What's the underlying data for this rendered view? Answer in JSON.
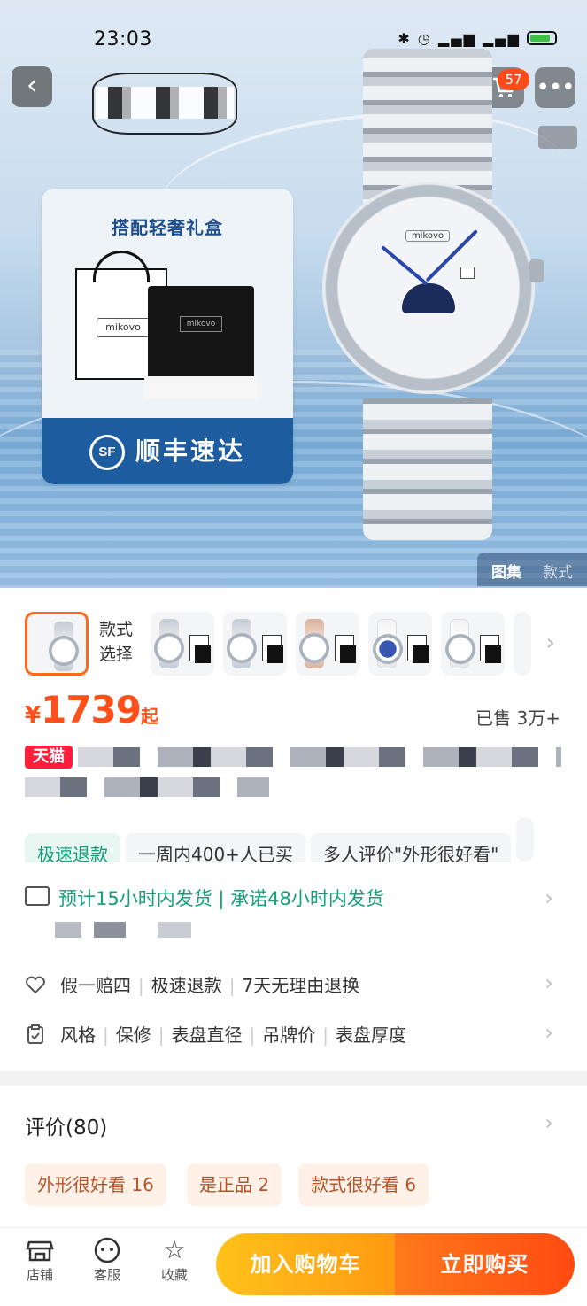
{
  "status_bar": {
    "time": "23:03",
    "battery": "91"
  },
  "nav": {
    "cart_count": "57"
  },
  "hero": {
    "gift_title": "搭配轻奢礼盒",
    "bag_label": "mikovo",
    "box_label": "mikovo",
    "shipping_banner": "顺丰速达",
    "sf_mark": "SF",
    "dial_brand": "mikovo",
    "gallery_tabs": [
      "图集",
      "款式"
    ]
  },
  "variants": {
    "label": "款式选择",
    "count": 6
  },
  "price": {
    "currency": "¥",
    "amount": "1739",
    "suffix": "起"
  },
  "sold": "已售 3万+",
  "title": {
    "platform": "天猫"
  },
  "tags": [
    "极速退款",
    "一周内400+人已买",
    "多人评价\"外形很好看\""
  ],
  "shipping": {
    "text": "预计15小时内发货 | 承诺48小时内发货"
  },
  "guarantees": [
    "假一赔四",
    "极速退款",
    "7天无理由退换"
  ],
  "params": [
    "风格",
    "保修",
    "表盘直径",
    "吊牌价",
    "表盘厚度"
  ],
  "reviews": {
    "title": "评价(80)",
    "tags": [
      "外形很好看 16",
      "是正品 2",
      "款式很好看 6"
    ]
  },
  "bottom_bar": {
    "shop": "店铺",
    "service": "客服",
    "favorite": "收藏",
    "add_to_cart": "加入购物车",
    "buy_now": "立即购买"
  },
  "colors": {
    "accent": "#ff4f1a",
    "green": "#13a07a",
    "sf_blue": "#1d5c9e"
  }
}
